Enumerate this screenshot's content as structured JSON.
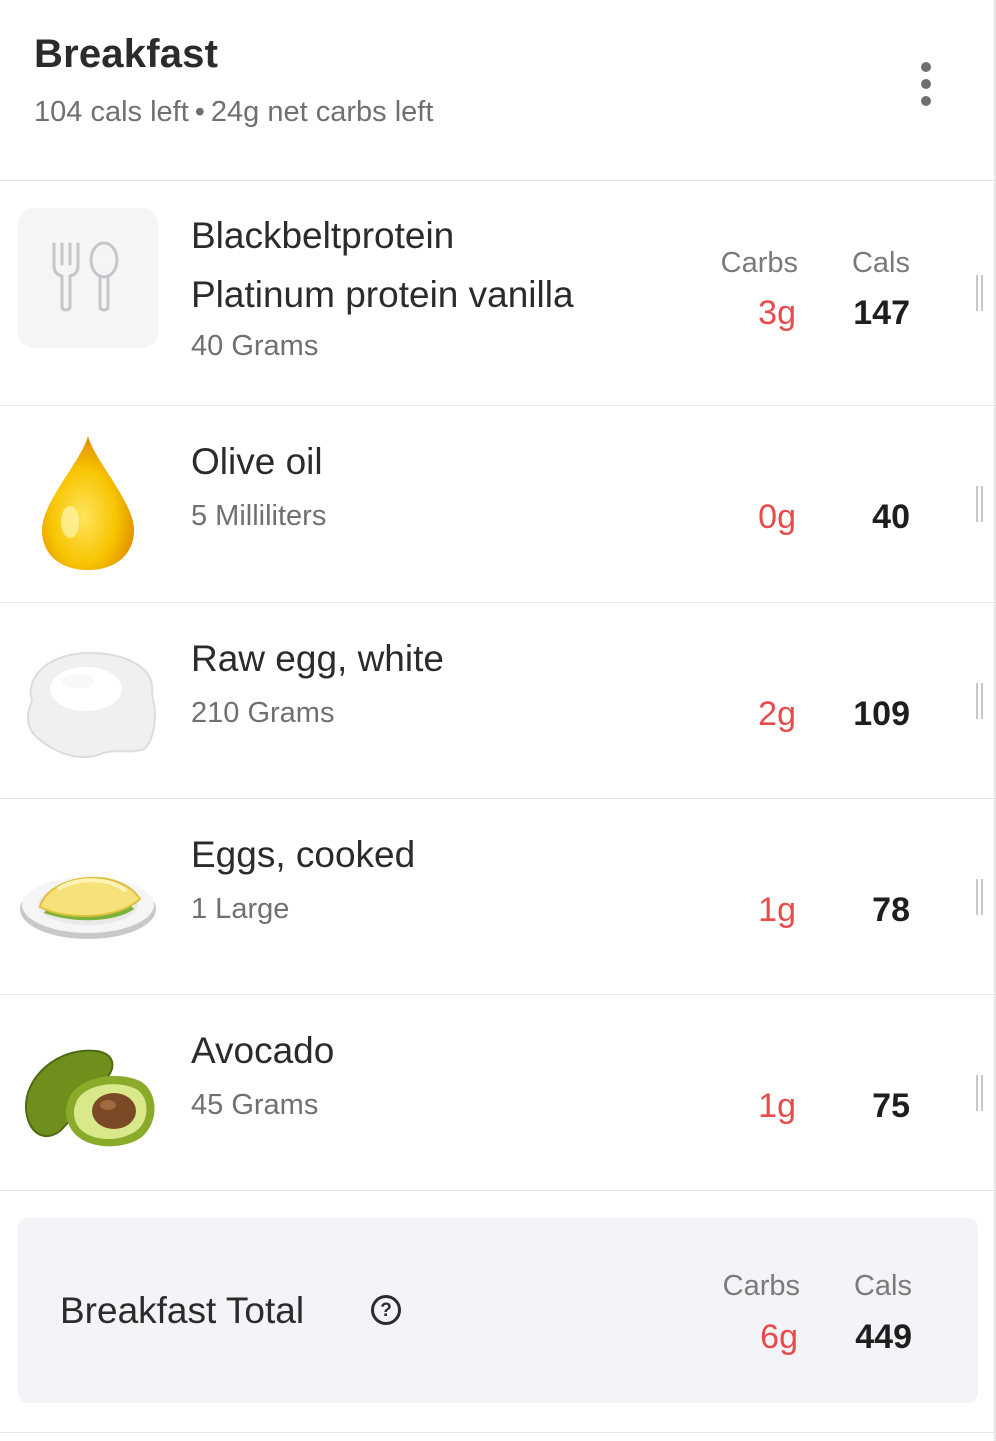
{
  "header": {
    "title": "Breakfast",
    "cals_left": "104 cals left",
    "separator": "•",
    "net_carbs_left": "24g net carbs left",
    "more_icon": "more-vertical-icon"
  },
  "columns": {
    "carbs": "Carbs",
    "cals": "Cals"
  },
  "items": [
    {
      "name_line1": "Blackbeltprotein",
      "name_line2": "Platinum protein vanilla",
      "quantity": "40 Grams",
      "carbs": "3g",
      "cals": "147",
      "icon": "utensils-icon"
    },
    {
      "name_line1": "Olive oil",
      "quantity": "5 Milliliters",
      "carbs": "0g",
      "cals": "40",
      "icon": "oil-drop-icon"
    },
    {
      "name_line1": "Raw egg, white",
      "quantity": "210 Grams",
      "carbs": "2g",
      "cals": "109",
      "icon": "egg-white-icon"
    },
    {
      "name_line1": "Eggs, cooked",
      "quantity": "1 Large",
      "carbs": "1g",
      "cals": "78",
      "icon": "omelette-icon"
    },
    {
      "name_line1": "Avocado",
      "quantity": "45 Grams",
      "carbs": "1g",
      "cals": "75",
      "icon": "avocado-icon"
    }
  ],
  "total": {
    "label": "Breakfast Total",
    "carbs": "6g",
    "cals": "449",
    "help_glyph": "?"
  },
  "colors": {
    "carbs_value": "#e94a4a",
    "text_primary": "#2b2b2b",
    "text_secondary": "#707070",
    "total_bg": "#f3f4f7"
  }
}
